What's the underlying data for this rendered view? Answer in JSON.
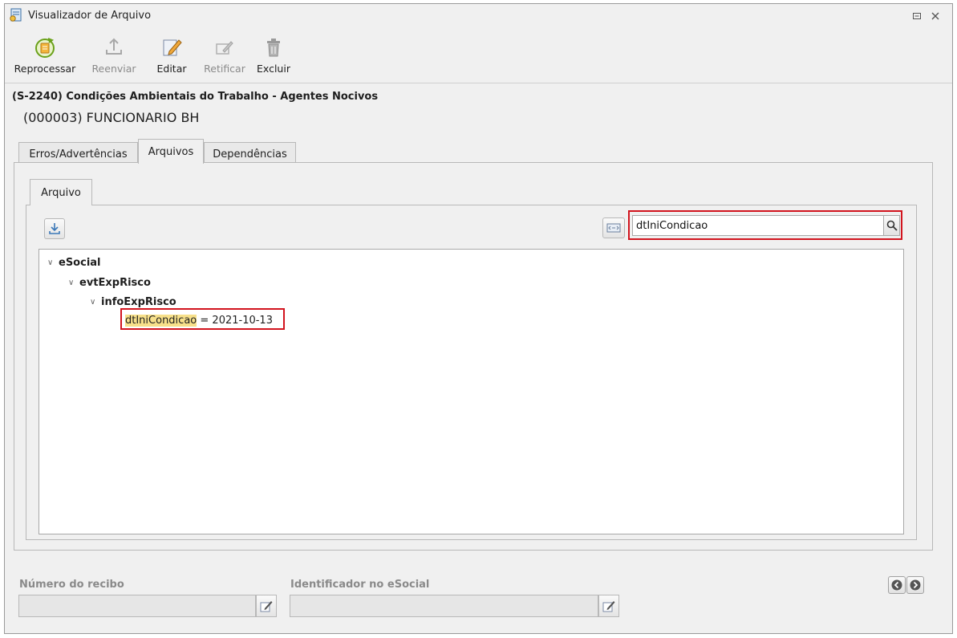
{
  "window": {
    "title": "Visualizador de Arquivo"
  },
  "toolbar": {
    "reprocess": "Reprocessar",
    "resend": "Reenviar",
    "edit": "Editar",
    "rectify": "Retificar",
    "delete": "Excluir"
  },
  "event": {
    "title": "(S-2240) Condições Ambientais do Trabalho - Agentes Nocivos",
    "employee": "(000003) FUNCIONARIO BH"
  },
  "tabs": [
    "Erros/Advertências",
    "Arquivos",
    "Dependências"
  ],
  "active_tab": "Arquivos",
  "subtab": "Arquivo",
  "search": {
    "value": "dtIniCondicao"
  },
  "tree": {
    "root": "eSocial",
    "child": "evtExpRisco",
    "grandchild": "infoExpRisco",
    "leaf_key": "dtIniCondicao",
    "leaf_sep": " = ",
    "leaf_value": "2021-10-13"
  },
  "fields": {
    "receipt_label": "Número do recibo",
    "esocial_id_label": "Identificador no eSocial"
  },
  "colors": {
    "highlight_border": "#d2141e",
    "match_highlight": "#f7e08a"
  }
}
